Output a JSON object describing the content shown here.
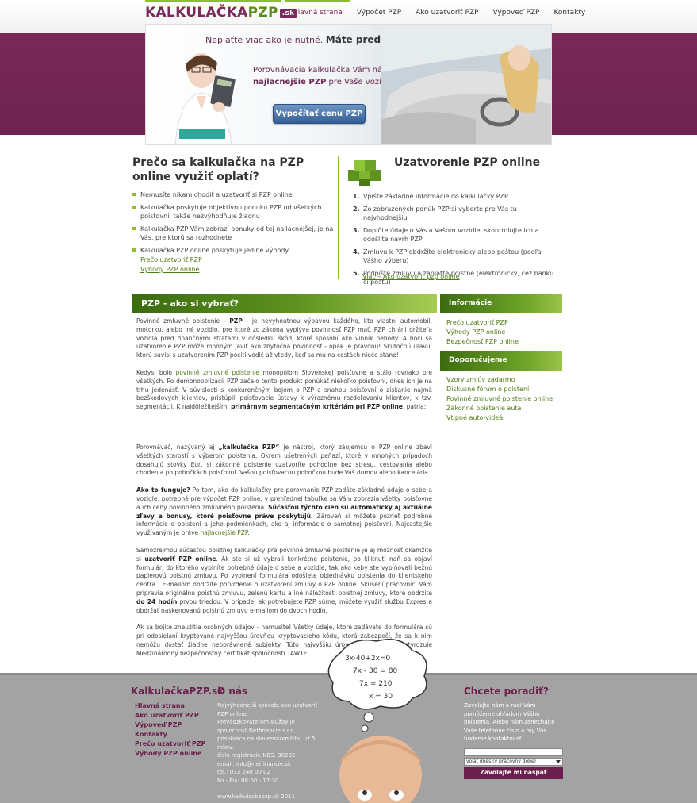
{
  "header": {
    "logo": {
      "main": "KALKULAČKA",
      "accent": "PZP",
      "tld": ".sk"
    },
    "nav": [
      {
        "label": "Hlavná strana",
        "active": true
      },
      {
        "label": "Výpočet PZP",
        "active": false
      },
      {
        "label": "Ako uzatvoriť PZP",
        "active": false
      },
      {
        "label": "Výpoveď PZP",
        "active": false
      },
      {
        "label": "Kontakty",
        "active": false
      }
    ]
  },
  "hero": {
    "tagline_normal": "Neplaťte viac ako je nutné.",
    "tagline_bold": "Máte predsa na výber.",
    "desc_before": "Porovnávacia kalkulačka Vám nájde to",
    "desc_bold": "najlacnejšie PZP",
    "desc_after": "pre Vaše vozidlo.",
    "button": "Vypočítať cenu PZP"
  },
  "intro_left": {
    "title": "Prečo sa kalkulačka na PZP online využiť oplatí?",
    "bullets": [
      "Nemusíte nikam chodiť a uzatvoriť si PZP online",
      "Kalkulačka poskytuje objektívnu ponuku PZP od všetkých poisťovní, takže nezvýhodňuje žiadnu",
      "Kalkulačka PZP Vám zobrazí ponuky od tej najlacnejšej, je na Vás, pre ktorú sa rozhodnete",
      "Kalkulačka PZP online poskytuje jediné výhody"
    ],
    "links": [
      "Prečo uzatvoriť PZP",
      "Výhody PZP online"
    ]
  },
  "intro_right": {
    "title": "Uzatvorenie PZP online",
    "steps": [
      {
        "n": "1.",
        "text": "Vpíšte základné informácie do kalkulačky PZP"
      },
      {
        "n": "2.",
        "text": "Zo zobrazených ponúk PZP si vyberte pre Vás tú najvhodnejšiu"
      },
      {
        "n": "3.",
        "text": "Doplňte údaje o Vás a Vašom vozidle, skontrolujte ich a odošlite návrh PZP"
      },
      {
        "n": "4.",
        "text": "Zmluvu k PZP obdržíte elektronicky alebo poštou (podľa Vášho výberu)"
      },
      {
        "n": "5.",
        "text": "Podpíšte zmluvu a zaplaťte poistné (elektronicky, cez banku či poštu)"
      }
    ],
    "link": "Viac – Ako uzatvoriť pzp online"
  },
  "article": {
    "heading": "PZP - ako si vybrať?",
    "p1": {
      "a": "Povinné zmluvné poistenie - ",
      "b": "PZP",
      "c": " - je nevyhnutnou výbavou každého, kto vlastní automobil, motorku, alebo iné vozidlo, pre ktoré zo zákona vyplýva povinnosť PZP mať. PZP chráni držiteľa vozidla pred finančnými stratami v dôsledku škôd, ktoré spôsobí ako vinník nehody. A hoci sa uzatvorenie PZP môže mnohým javiť ako zbytočná povinnosť - opak je pravdou! Skutočnú úľavu, ktorú súvisí s uzatvorením PZP pocíti vodič až vtedy, keď sa mu na cestách niečo stane!"
    },
    "p2": {
      "a": "Kedysi bolo ",
      "link": "povinné zmluvné poistenie",
      "b": " monopolom Slovenskej poisťovne a stálo rovnako pre všetkých. Po demonopolizácii PZP začalo tento produkt ponúkať niekoľko poisťovní, dnes ich je na trhu jedenásť. V súvislosti s konkurenčným bojom o PZP a snahou poisťovní o získanie najmä bezškodových klientov, pristúpili poisťovacie ústavy k výraznému rozdeľovaniu klientov, k tzv. segmentácii. K najdôležitejším, ",
      "c": "primárnym segmentačným kritériám pri PZP online",
      "d": ", patria:"
    },
    "p3": {
      "a": "Porovnávač, nazývaný aj ",
      "b": "„kalkulačka PZP“",
      "c": " je nástroj, ktorý záujemcu o PZP online zbaví všetkých starostí s výberom poistenia. Okrem ušetrených peňazí, ktoré v mnohých prípadoch dosahujú stovky Eur, si zákonné poistenie uzatvoríte pohodlne bez stresu, cestovania alebo chodenia po pobočkách poisťovní. Vašou poisťovacou pobočkou bude Váš domov alebo kancelária."
    },
    "p4": {
      "a": "Ako to funguje?",
      "b": " Po tom, ako do kalkulačky pre porovnanie PZP zadáte základné údaje o sebe a vozidle, potrebné pre výpočet PZP online, v prehľadnej tabuľke sa Vám zobrazia všetky poisťovne a ich ceny povinného zmluvného poistenia. ",
      "c": "Súčasťou týchto cien sú automaticky aj aktuálne zľavy a bonusy, ktoré poisťovne práve poskytujú.",
      "d": " Zároveň si môžete pozrieť podrobné informácie o poistení a jeho podmienkach, ako aj informácie o samotnej poisťovni. Najčastejšie využívaným je práve ",
      "link": "najlacnejšie PZP",
      "e": "."
    },
    "p5": {
      "a": "Samozrejmou súčasťou poistnej kalkulačky pre povinné zmluvné poistenie je aj možnosť okamžite si ",
      "b": "uzatvoriť PZP online",
      "c": ". Ak ste si už vybrali konkrétne poistenie, po kliknutí naň sa objaví formulár, do ktorého vyplníte potrebné údaje o sebe a vozidle, tak ako keby ste vypĺňovali bežnú papierovú poistnú zmluvu. Po vyplnení formulára odošlete objednávku poistenia do klientskeho centra . E-mailom obdržíte potvrdenie o uzatvorení zmluvy o PZP online. Skúsení pracovníci Vám pripravia originálnu poistnú zmluvu, zelenú kartu a iné náležitosti poistnej zmluvy, ktoré obdržíte ",
      "d": "do 24 hodín",
      "e": " prvou triedou. V prípade, ak potrebujete PZP súrne, môžete využiť službu Expres a obdržať naskenovanú poistnú zmluvu e-mailom do dvoch hodín."
    },
    "p6": "Ak sa bojíte zneužitia osobných údajov - nemusíte! Všetky údaje, ktoré zadávate do formulára sú pri odosielaní kryptované najvyššou úrovňou kryptovacieho kódu, ktorá zabezpečí, že sa k nim nemôžu dostať žiadne neoprávnené subjekty. Túto najvyššiu úroveň bezpečnosti potvrdzuje Medzinárodný bezpečnostný certifikát spoločnosti TAWTE."
  },
  "sidebar": {
    "info_title": "Informácie",
    "info_links": [
      "Prečo uzatvoriť PZP",
      "Výhody PZP online",
      "Bezpečnosť PZP online"
    ],
    "rec_title": "Doporučujeme",
    "rec_links": [
      "Vzory zmlúv zadarmo",
      "Diskusné fórum o poistení.",
      "Povinné zmluvné poistenie online",
      "Zákonné poistenie auta",
      "Vtipné auto-videá"
    ]
  },
  "footer": {
    "brand": "KalkulačkaPZP.sk",
    "nav": [
      "Hlavná strana",
      "Ako uzatvoriť PZP",
      "Výpoveď PZP",
      "Kontakty",
      "Prečo uzatvoriť PZP",
      "Výhody PZP online"
    ],
    "about_title": "O nás",
    "about_lines": [
      "Najvýhodnejší spôsob, ako uzatvoriť PZP online.",
      "Prevádzkovateľom služby je spoločnosť Netfinancie s.r.o. pôsobiaca na slovenskom trhu už 5 rokov.",
      "číslo registrácie NBS: 30232",
      "email: info@netfinancie.sk",
      "tel.: 033 240 00 02",
      "Po - Pia: 08:00 - 17:30",
      "www.kalkulackapzp.sk 2011"
    ],
    "advice_title": "Chcete poradiť?",
    "advice_text": "Zavolajte nám a radi Vám pomôžeme ohľadom Vášho poistenia. Alebo nám zanechajte Vaše telefónne číslo a my Vás budeme kontaktovať.",
    "select_value": "volať dnes (v pracovný dobe)",
    "button": "Zavolajte mi naspäť"
  },
  "colors": {
    "purple": "#7a2857",
    "green": "#8cbf2a",
    "dark_green": "#4f7a14",
    "footer_gray": "#a3a3a3"
  }
}
